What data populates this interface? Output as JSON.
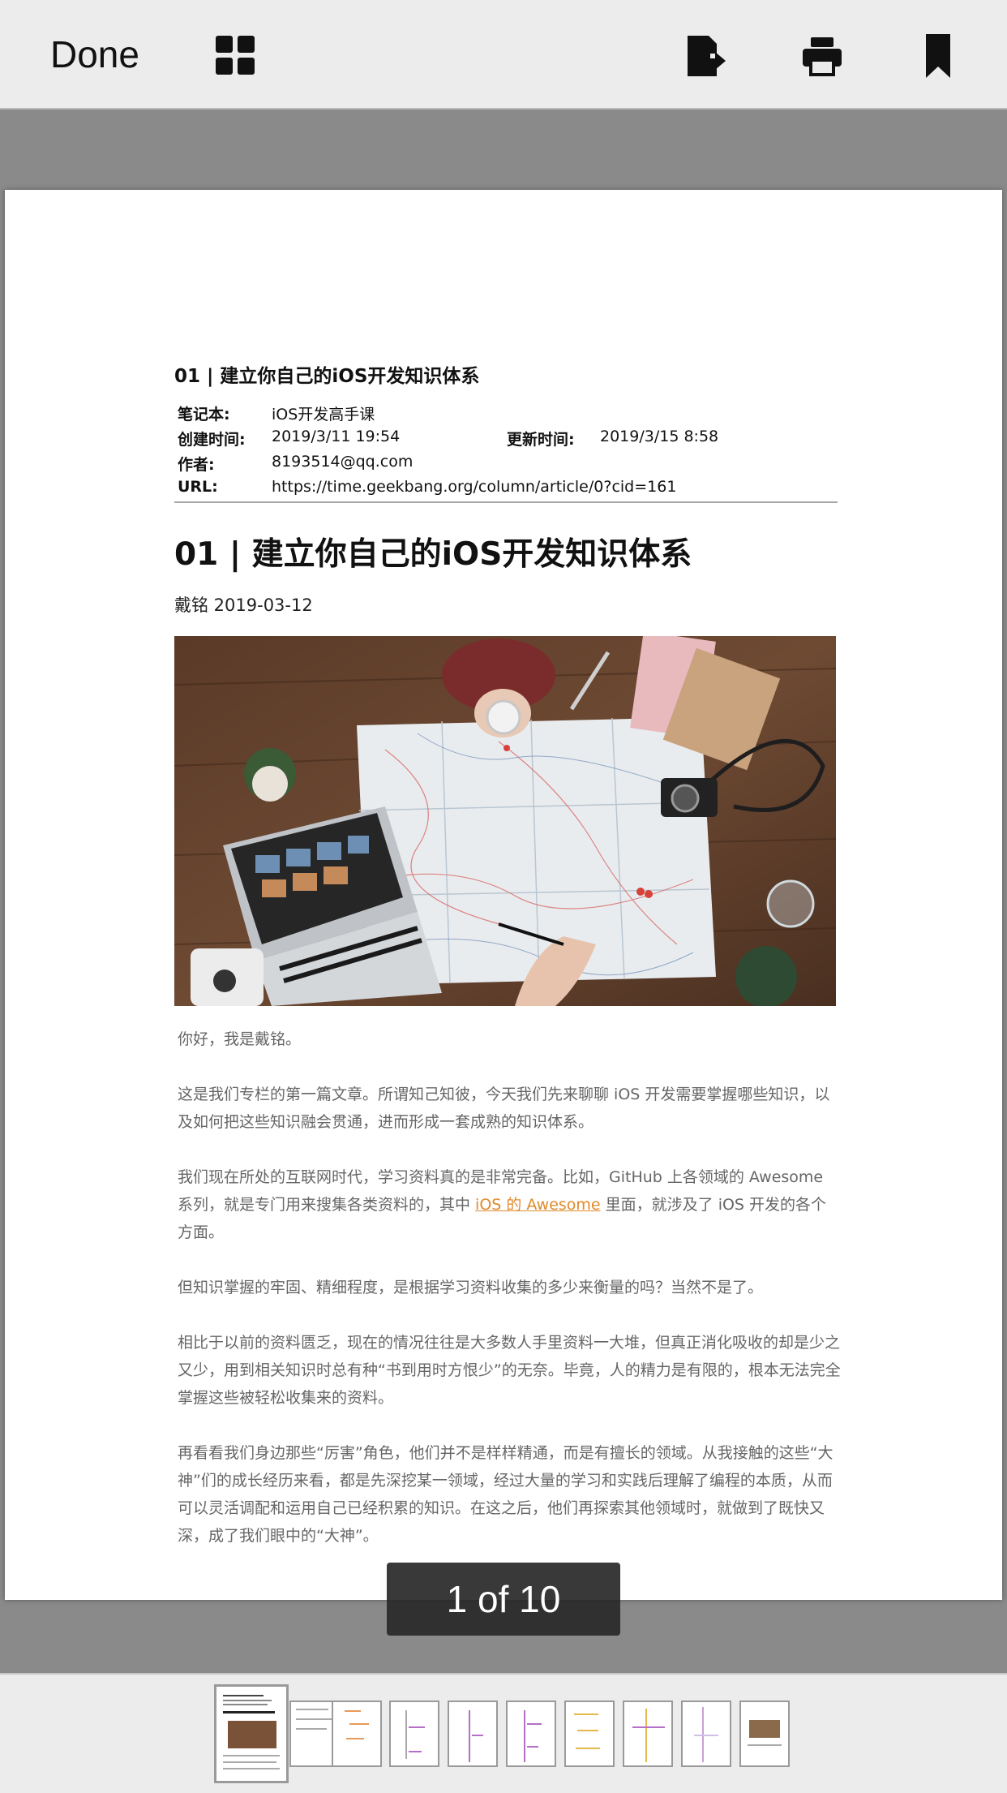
{
  "toolbar": {
    "done_label": "Done",
    "icons": [
      "grid-icon",
      "export-icon",
      "print-icon",
      "bookmark-icon"
    ]
  },
  "document": {
    "note_title": "01 | 建立你自己的iOS开发知识体系",
    "meta": {
      "notebook_label": "笔记本:",
      "notebook_value": "iOS开发高手课",
      "created_label": "创建时间:",
      "created_value": "2019/3/11 19:54",
      "updated_label": "更新时间:",
      "updated_value": "2019/3/15 8:58",
      "author_label": "作者:",
      "author_value": "8193514@qq.com",
      "url_label": "URL:",
      "url_value": "https://time.geekbang.org/column/article/0?cid=161"
    },
    "article_title": "01 | 建立你自己的iOS开发知识体系",
    "byline": "戴铭 2019-03-12",
    "paragraphs": {
      "p1": "你好，我是戴铭。",
      "p2": "这是我们专栏的第一篇文章。所谓知己知彼，今天我们先来聊聊 iOS 开发需要掌握哪些知识，以及如何把这些知识融会贯通，进而形成一套成熟的知识体系。",
      "p3_before": "我们现在所处的互联网时代，学习资料真的是非常完备。比如，GitHub 上各领域的 Awesome 系列，就是专门用来搜集各类资料的，其中 ",
      "p3_link": "iOS 的 Awesome",
      "p3_after": " 里面，就涉及了 iOS 开发的各个方面。",
      "p4": "但知识掌握的牢固、精细程度，是根据学习资料收集的多少来衡量的吗？当然不是了。",
      "p5": "相比于以前的资料匮乏，现在的情况往往是大多数人手里资料一大堆，但真正消化吸收的却是少之又少，用到相关知识时总有种“书到用时方恨少”的无奈。毕竟，人的精力是有限的，根本无法完全掌握这些被轻松收集来的资料。",
      "p6": "再看看我们身边那些“厉害”角色，他们并不是样样精通，而是有擅长的领域。从我接触的这些“大神”们的成长经历来看，都是先深挖某一领域，经过大量的学习和实践后理解了编程的本质，从而可以灵活调配和运用自己已经积累的知识。在这之后，他们再探索其他领域时，就做到了既快又深，成了我们眼中的“大神”。"
    }
  },
  "page_indicator": "1 of 10",
  "thumbnails": {
    "count": 10,
    "current_index": 0
  },
  "colors": {
    "link": "#e08a2c",
    "toolbar_bg": "#ececec",
    "viewer_bg": "#8a8a8a"
  }
}
